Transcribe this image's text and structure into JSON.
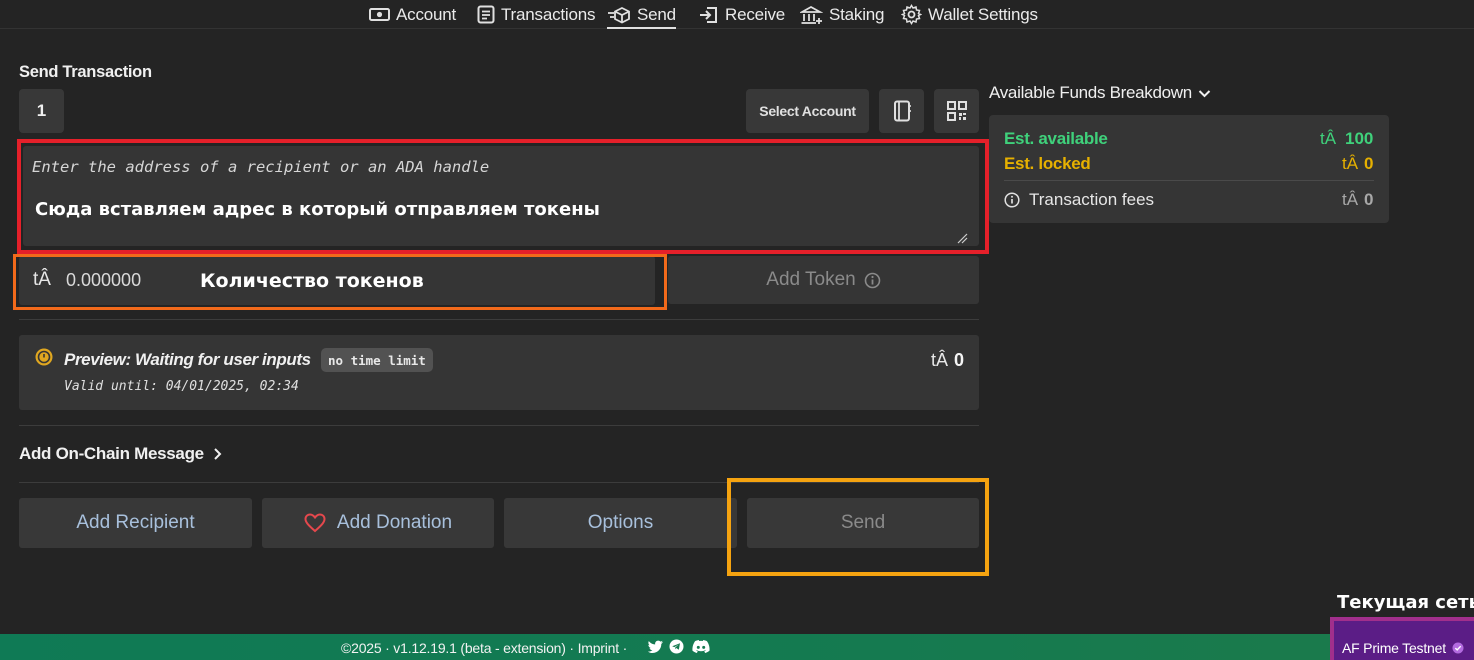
{
  "nav": {
    "account": "Account",
    "transactions": "Transactions",
    "send": "Send",
    "receive": "Receive",
    "staking": "Staking",
    "wallet_settings": "Wallet Settings"
  },
  "send": {
    "title": "Send Transaction",
    "recipient_index": "1",
    "select_account": "Select Account",
    "address_placeholder": "Enter the address of a recipient or an ADA handle",
    "address_note": "Сюда вставляем адрес в который отправляем токены",
    "currency_symbol": "tÂ",
    "amount_value": "0.000000",
    "amount_note": "Количество токенов",
    "add_token": "Add Token"
  },
  "preview": {
    "title": "Preview: Waiting for user inputs",
    "badge": "no time limit",
    "valid_until": "Valid until: 04/01/2025, 02:34",
    "currency_symbol": "tÂ",
    "amount": "0"
  },
  "message": {
    "label": "Add On-Chain Message"
  },
  "actions": {
    "add_recipient": "Add Recipient",
    "add_donation": "Add Donation",
    "options": "Options",
    "send": "Send"
  },
  "funds": {
    "title": "Available Funds Breakdown",
    "available_label": "Est. available",
    "available_symbol": "tÂ",
    "available_value": "100",
    "locked_label": "Est. locked",
    "locked_symbol": "tÂ",
    "locked_value": "0",
    "fees_label": "Transaction fees",
    "fees_symbol": "tÂ",
    "fees_value": "0"
  },
  "footer": {
    "text": "©2025 · v1.12.19.1 (beta - extension) · Imprint ·",
    "network_note": "Текущая сеть",
    "network": "AF Prime Testnet"
  },
  "colors": {
    "background": "#242424",
    "card": "#353535",
    "available_green": "#3fd17b",
    "locked_amber": "#e6b000",
    "button_text": "#a8c0dc",
    "annotation_red": "#e5202a",
    "annotation_orange": "#f26a1b",
    "annotation_amber": "#f5a310",
    "annotation_magenta": "#a12f8c",
    "footer_green": "#157a50"
  }
}
